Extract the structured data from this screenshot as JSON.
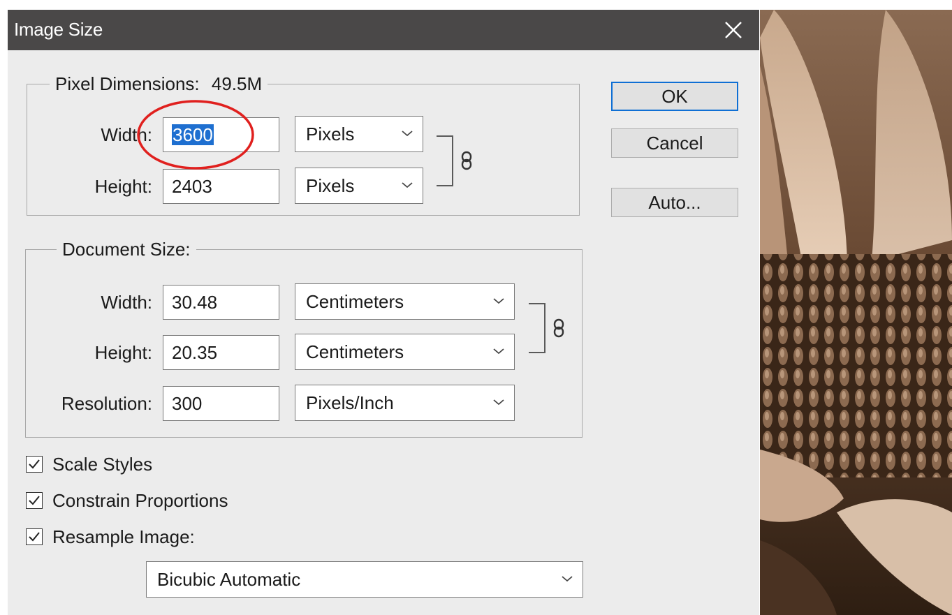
{
  "dialog": {
    "title": "Image Size"
  },
  "pixel_dimensions": {
    "legend_label": "Pixel Dimensions:",
    "size": "49.5M",
    "width_label": "Width:",
    "width_value": "3600",
    "width_unit": "Pixels",
    "height_label": "Height:",
    "height_value": "2403",
    "height_unit": "Pixels"
  },
  "document_size": {
    "legend_label": "Document Size:",
    "width_label": "Width:",
    "width_value": "30.48",
    "width_unit": "Centimeters",
    "height_label": "Height:",
    "height_value": "20.35",
    "height_unit": "Centimeters",
    "resolution_label": "Resolution:",
    "resolution_value": "300",
    "resolution_unit": "Pixels/Inch"
  },
  "buttons": {
    "ok": "OK",
    "cancel": "Cancel",
    "auto": "Auto..."
  },
  "options": {
    "scale_styles": {
      "label": "Scale Styles",
      "checked": true
    },
    "constrain_proportions": {
      "label": "Constrain Proportions",
      "checked": true
    },
    "resample_image": {
      "label": "Resample Image:",
      "checked": true
    },
    "resample_method": "Bicubic Automatic"
  },
  "colors": {
    "titlebar": "#4a4848",
    "dialog_bg": "#ececec",
    "selection": "#1e6fd0",
    "default_button_border": "#0f6fd4",
    "annotation_circle": "#e0201e"
  },
  "icons": {
    "close": "close-icon",
    "link": "chain-link-icon",
    "dropdown": "chevron-down-icon",
    "check": "checkmark-icon"
  }
}
